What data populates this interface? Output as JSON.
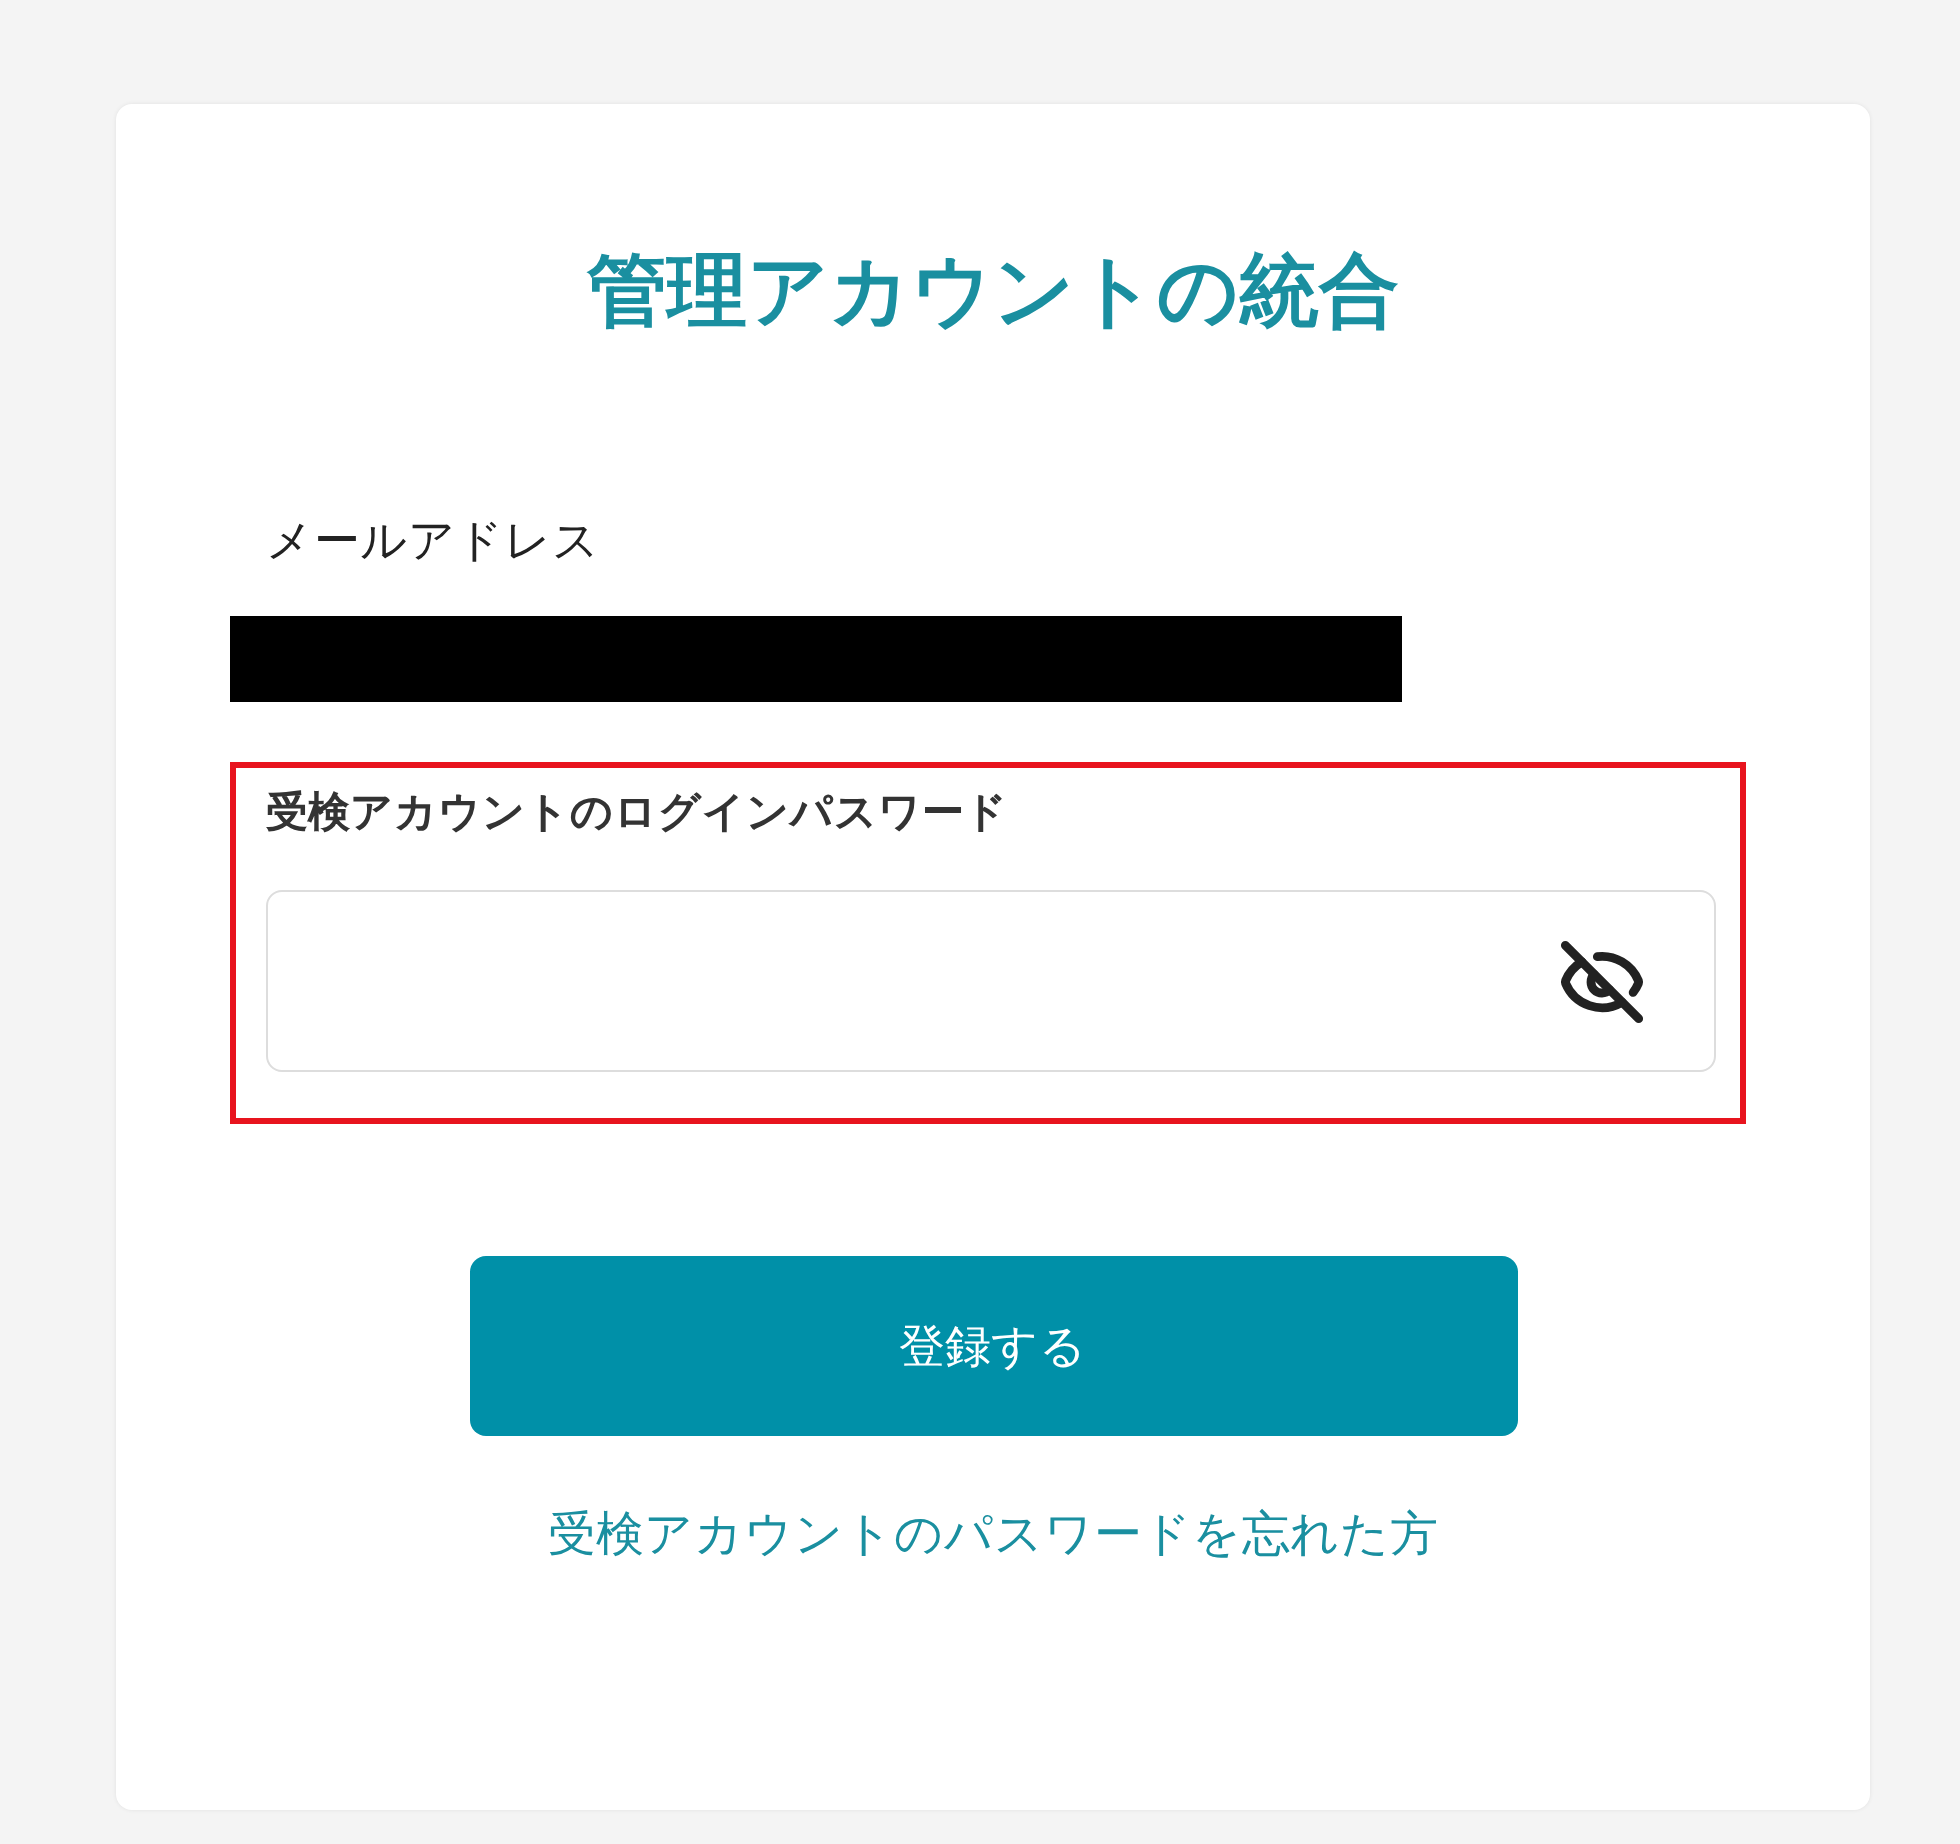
{
  "title": "管理アカウントの統合",
  "email": {
    "label": "メールアドレス",
    "redacted": true
  },
  "password": {
    "label": "受検アカウントのログインパスワード",
    "highlighted": true,
    "visible": false
  },
  "submit_button": "登録する",
  "forgot_link": "受検アカウントのパスワードを忘れた方"
}
